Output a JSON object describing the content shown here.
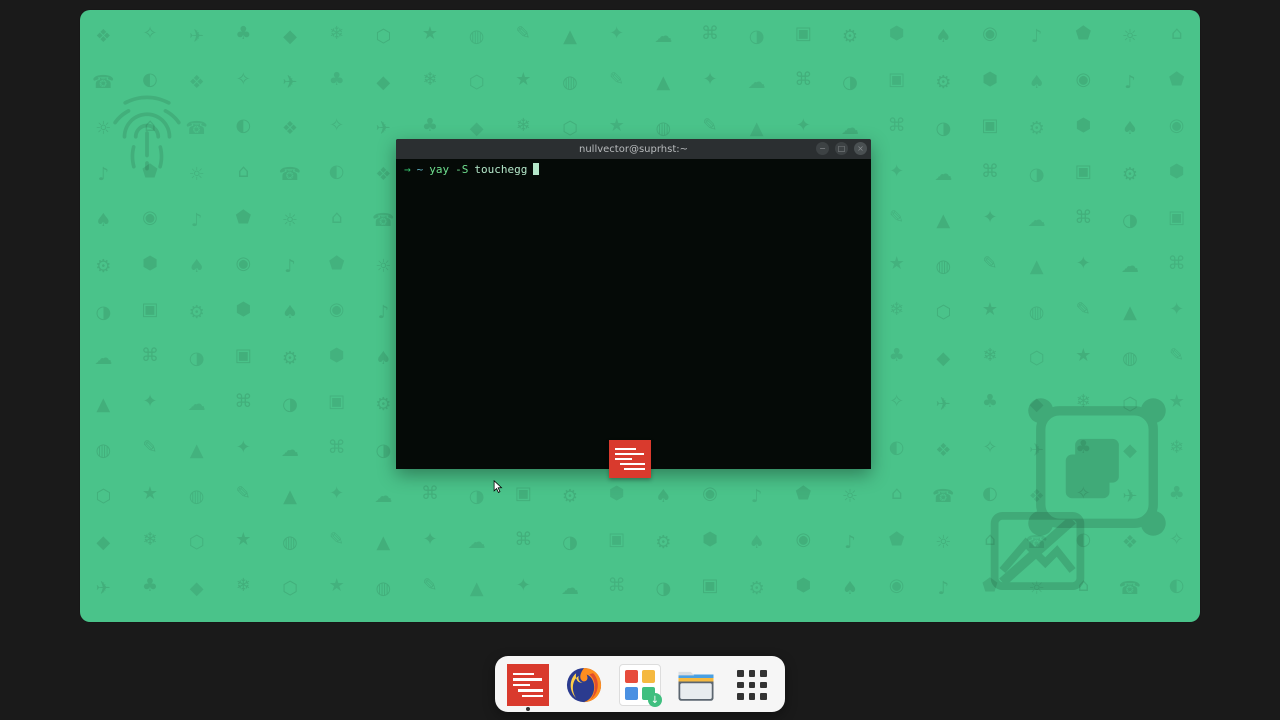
{
  "terminal": {
    "title": "nullvector@suprhst:~",
    "prompt": {
      "arrow": "→",
      "path": "~",
      "cmd": "yay",
      "flag": "-S",
      "arg": "touchegg"
    },
    "controls": {
      "minimize": "−",
      "maximize": "□",
      "close": "×"
    }
  },
  "dock": {
    "items": [
      {
        "name": "news-reader",
        "running": true
      },
      {
        "name": "firefox",
        "running": false
      },
      {
        "name": "software",
        "running": false
      },
      {
        "name": "files",
        "running": false
      },
      {
        "name": "app-grid",
        "running": false
      }
    ]
  },
  "colors": {
    "desktop": "#4ac38a",
    "accent_red": "#d93a2d"
  }
}
